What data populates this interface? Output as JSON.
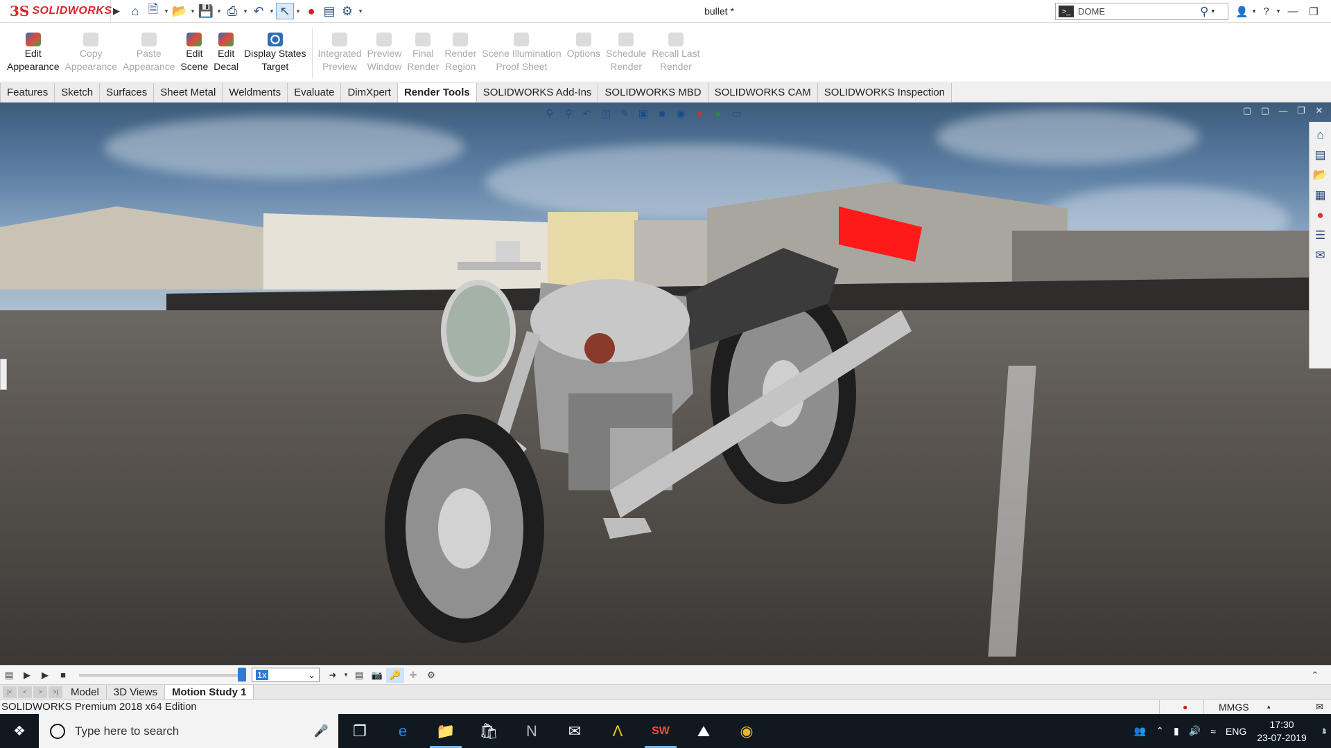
{
  "titlebar": {
    "brand_mark": "3S",
    "brand_name": "SOLIDWORKS",
    "document_title": "bullet *",
    "search": {
      "value": "DOME",
      "placeholder": ""
    },
    "quick_access_icons": [
      "home-icon",
      "new-document-icon",
      "open-icon",
      "save-icon",
      "print-icon",
      "undo-icon",
      "select-icon",
      "rebuild-icon",
      "file-properties-icon",
      "options-gear-icon"
    ],
    "window_controls": [
      "user-icon",
      "help-icon",
      "minimize-icon",
      "restore-icon",
      "close-icon"
    ]
  },
  "command_manager": {
    "tools": [
      {
        "line1": "Edit",
        "line2": "Appearance",
        "enabled": true
      },
      {
        "line1": "Copy",
        "line2": "Appearance",
        "enabled": false
      },
      {
        "line1": "Paste",
        "line2": "Appearance",
        "enabled": false
      },
      {
        "line1": "Edit",
        "line2": "Scene",
        "enabled": true
      },
      {
        "line1": "Edit",
        "line2": "Decal",
        "enabled": true
      },
      {
        "line1": "Display States",
        "line2": "Target",
        "enabled": true
      },
      {
        "line1": "Integrated",
        "line2": "Preview",
        "enabled": false
      },
      {
        "line1": "Preview",
        "line2": "Window",
        "enabled": false
      },
      {
        "line1": "Final",
        "line2": "Render",
        "enabled": false
      },
      {
        "line1": "Render",
        "line2": "Region",
        "enabled": false
      },
      {
        "line1": "Scene Illumination",
        "line2": "Proof Sheet",
        "enabled": false
      },
      {
        "line1": "Options",
        "line2": "",
        "enabled": false
      },
      {
        "line1": "Schedule",
        "line2": "Render",
        "enabled": false
      },
      {
        "line1": "Recall Last",
        "line2": "Render",
        "enabled": false
      }
    ]
  },
  "tabs": [
    "Features",
    "Sketch",
    "Surfaces",
    "Sheet Metal",
    "Weldments",
    "Evaluate",
    "DimXpert",
    "Render Tools",
    "SOLIDWORKS Add-Ins",
    "SOLIDWORKS MBD",
    "SOLIDWORKS CAM",
    "SOLIDWORKS Inspection"
  ],
  "active_tab": "Render Tools",
  "viewport": {
    "heads_up_icons": [
      "zoom-to-fit-icon",
      "zoom-area-icon",
      "previous-view-icon",
      "section-view-icon",
      "dynamic-annotation-icon",
      "view-orientation-icon",
      "display-style-icon",
      "hide-show-icon",
      "edit-appearance-icon",
      "apply-scene-icon",
      "view-settings-icon"
    ],
    "task_pane_icons": [
      "solidworks-resources-icon",
      "design-library-icon",
      "file-explorer-icon",
      "view-palette-icon",
      "appearances-icon",
      "custom-properties-icon",
      "forum-icon"
    ]
  },
  "motion_study": {
    "speed_value": "1x",
    "tabs": [
      "Model",
      "3D Views",
      "Motion Study 1"
    ],
    "active_tab": "Motion Study 1"
  },
  "statusbar": {
    "edition": "SOLIDWORKS Premium 2018 x64 Edition",
    "units": "MMGS"
  },
  "taskbar": {
    "search_placeholder": "Type here to search",
    "language": "ENG",
    "time": "17:30",
    "date": "23-07-2019",
    "notification_count": "1"
  }
}
